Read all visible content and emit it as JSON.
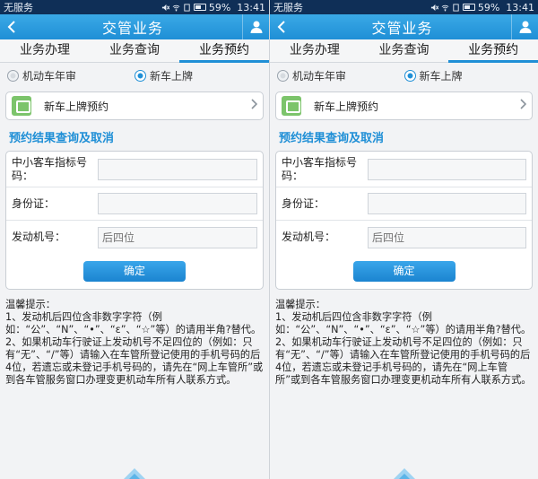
{
  "status": {
    "carrier": "无服务",
    "battery": "59%",
    "time": "13:41"
  },
  "header": {
    "title": "交管业务",
    "back_icon": "back-arrow-icon",
    "user_icon": "user-icon"
  },
  "tabs": [
    {
      "label": "业务办理"
    },
    {
      "label": "业务查询"
    },
    {
      "label": "业务预约",
      "active": true
    }
  ],
  "radios": [
    {
      "label": "机动车年审",
      "selected": false
    },
    {
      "label": "新车上牌",
      "selected": true
    }
  ],
  "select_card": {
    "label": "新车上牌预约",
    "icon": "calendar-icon"
  },
  "section_title": "预约结果查询及取消",
  "form": {
    "plate_label": "中小客车指标号码：",
    "plate_value": "",
    "id_label": "身份证：",
    "id_value": "",
    "engine_label": "发动机号：",
    "engine_placeholder": "后四位",
    "confirm_label": "确定"
  },
  "tips": [
    "温馨提示：",
    "1、发动机后四位含非数字字符（例如：“公”、“N”、“•”、“ε”、“☆”等）的请用半角?替代。",
    "2、如果机动车行驶证上发动机号不足四位的（例如：只有“无”、“/”等）请输入在车管所登记使用的手机号码的后4位，若遗忘或未登记手机号码的，请先在“网上车管所”或到各车管服务窗口办理变更机动车所有人联系方式。"
  ],
  "colors": {
    "accent": "#1f8fd6",
    "status_bar": "#0f2f57",
    "icon_green": "#7cc46b"
  }
}
